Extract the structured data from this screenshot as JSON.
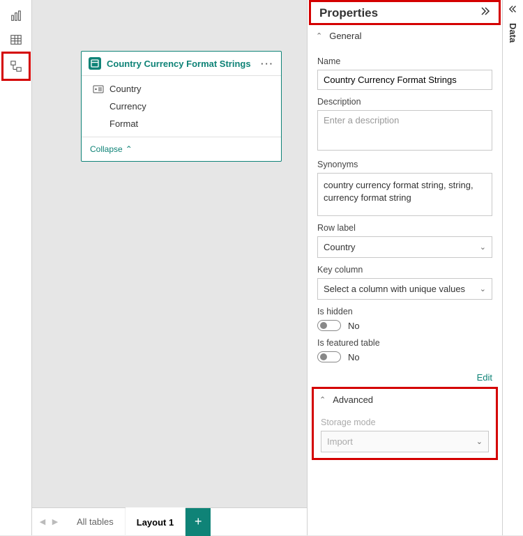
{
  "properties": {
    "title": "Properties",
    "general": {
      "header": "General",
      "name_label": "Name",
      "name_value": "Country Currency Format Strings",
      "description_label": "Description",
      "description_placeholder": "Enter a description",
      "synonyms_label": "Synonyms",
      "synonyms_value": "country currency format string, string, currency format string",
      "row_label_label": "Row label",
      "row_label_value": "Country",
      "key_column_label": "Key column",
      "key_column_placeholder": "Select a column with unique values",
      "is_hidden_label": "Is hidden",
      "is_hidden_value": "No",
      "is_featured_label": "Is featured table",
      "is_featured_value": "No",
      "edit_link": "Edit"
    },
    "advanced": {
      "header": "Advanced",
      "storage_mode_label": "Storage mode",
      "storage_mode_value": "Import"
    }
  },
  "data_panel": {
    "title": "Data"
  },
  "table_card": {
    "title": "Country Currency Format Strings",
    "fields": [
      "Country",
      "Currency",
      "Format"
    ],
    "collapse": "Collapse"
  },
  "bottom_tabs": {
    "all_tables": "All tables",
    "layout1": "Layout 1"
  }
}
